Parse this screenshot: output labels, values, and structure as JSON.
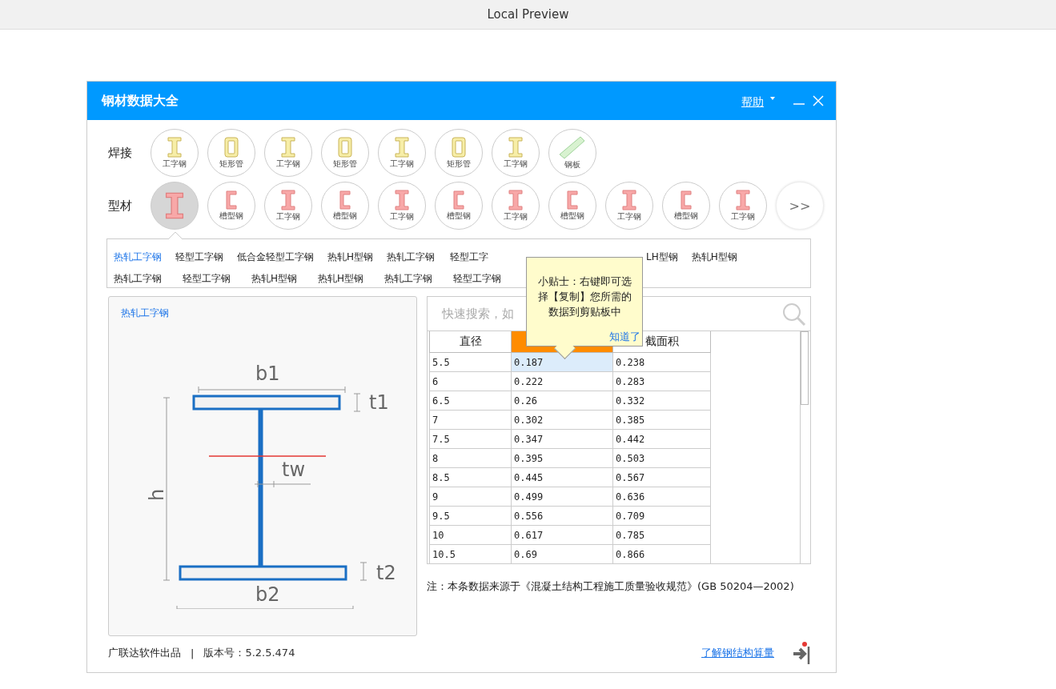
{
  "browser": {
    "title": "Local Preview"
  },
  "window": {
    "title": "钢材数据大全",
    "help": "帮助"
  },
  "groups": [
    {
      "label": "焊接",
      "kind": "weld",
      "tiles": [
        {
          "kind": "ibeam",
          "label": "工字钢",
          "selected": false
        },
        {
          "kind": "tube",
          "label": "矩形管",
          "selected": false
        },
        {
          "kind": "ibeam",
          "label": "工字钢",
          "selected": false
        },
        {
          "kind": "tube",
          "label": "矩形管",
          "selected": false
        },
        {
          "kind": "ibeam",
          "label": "工字钢",
          "selected": false
        },
        {
          "kind": "tube",
          "label": "矩形管",
          "selected": false
        },
        {
          "kind": "ibeam",
          "label": "工字钢",
          "selected": false
        },
        {
          "kind": "plate",
          "label": "钢板",
          "selected": false
        }
      ]
    },
    {
      "label": "型材",
      "kind": "profile",
      "tiles": [
        {
          "kind": "ibeam",
          "selected": true
        },
        {
          "kind": "channel",
          "label": "槽型钢",
          "selected": false
        },
        {
          "kind": "ibeam",
          "label": "工字钢",
          "selected": false
        },
        {
          "kind": "channel",
          "label": "槽型钢",
          "selected": false
        },
        {
          "kind": "ibeam",
          "label": "工字钢",
          "selected": false
        },
        {
          "kind": "channel",
          "label": "槽型钢",
          "selected": false
        },
        {
          "kind": "ibeam",
          "label": "工字钢",
          "selected": false
        },
        {
          "kind": "channel",
          "label": "槽型钢",
          "selected": false
        },
        {
          "kind": "ibeam",
          "label": "工字钢",
          "selected": false
        },
        {
          "kind": "channel",
          "label": "槽型钢",
          "selected": false
        },
        {
          "kind": "ibeam",
          "label": "工字钢",
          "selected": false
        },
        {
          "kind": "more",
          "label": ">>",
          "selected": false
        }
      ]
    }
  ],
  "categories": [
    [
      {
        "label": "热轧工字钢",
        "selected": true
      },
      {
        "label": "轻型工字钢",
        "selected": false
      },
      {
        "label": "低合金轻型工字钢",
        "selected": false
      },
      {
        "label": "热轧H型钢",
        "selected": false
      },
      {
        "label": "热轧工字钢",
        "selected": false
      },
      {
        "label": "轻型工字",
        "selected": false
      },
      {
        "label": "LH型钢",
        "selected": false
      },
      {
        "label": "热轧H型钢",
        "selected": false
      }
    ],
    [
      {
        "label": "热轧工字钢",
        "selected": false
      },
      {
        "label": "轻型工字钢",
        "selected": false
      },
      {
        "label": "热轧H型钢",
        "selected": false
      },
      {
        "label": "热轧H型钢",
        "selected": false
      },
      {
        "label": "热轧工字钢",
        "selected": false
      },
      {
        "label": "轻型工字钢",
        "selected": false
      }
    ]
  ],
  "diagram": {
    "title": "热轧工字钢",
    "labels": {
      "b1": "b1",
      "t1": "t1",
      "tw": "tw",
      "h": "h",
      "t2": "t2",
      "b2": "b2"
    }
  },
  "search": {
    "placeholder": "快速搜索，如"
  },
  "table": {
    "columns": [
      {
        "label": "直径",
        "selected": false
      },
      {
        "selected": true
      },
      {
        "label": "截面积",
        "selected": false
      }
    ],
    "rows": [
      {
        "cells": [
          "5.5",
          "0.187",
          "0.238"
        ],
        "selected": true
      },
      {
        "cells": [
          "6",
          "0.222",
          "0.283"
        ],
        "selected": false
      },
      {
        "cells": [
          "6.5",
          "0.26",
          "0.332"
        ],
        "selected": false
      },
      {
        "cells": [
          "7",
          "0.302",
          "0.385"
        ],
        "selected": false
      },
      {
        "cells": [
          "7.5",
          "0.347",
          "0.442"
        ],
        "selected": false
      },
      {
        "cells": [
          "8",
          "0.395",
          "0.503"
        ],
        "selected": false
      },
      {
        "cells": [
          "8.5",
          "0.445",
          "0.567"
        ],
        "selected": false
      },
      {
        "cells": [
          "9",
          "0.499",
          "0.636"
        ],
        "selected": false
      },
      {
        "cells": [
          "9.5",
          "0.556",
          "0.709"
        ],
        "selected": false
      },
      {
        "cells": [
          "10",
          "0.617",
          "0.785"
        ],
        "selected": false
      },
      {
        "cells": [
          "10.5",
          "0.69",
          "0.866"
        ],
        "selected": false
      }
    ]
  },
  "tooltip": {
    "text": "小贴士：右键即可选择【复制】您所需的数据到剪贴板中",
    "link": "知道了"
  },
  "note": "注：本条数据来源于《混凝土结构工程施工质量验收规范》(GB 50204—2002)",
  "footer": {
    "maker": "广联达软件出品",
    "separator": "|",
    "version": "版本号：5.2.5.474",
    "link": "了解钢结构算量"
  }
}
